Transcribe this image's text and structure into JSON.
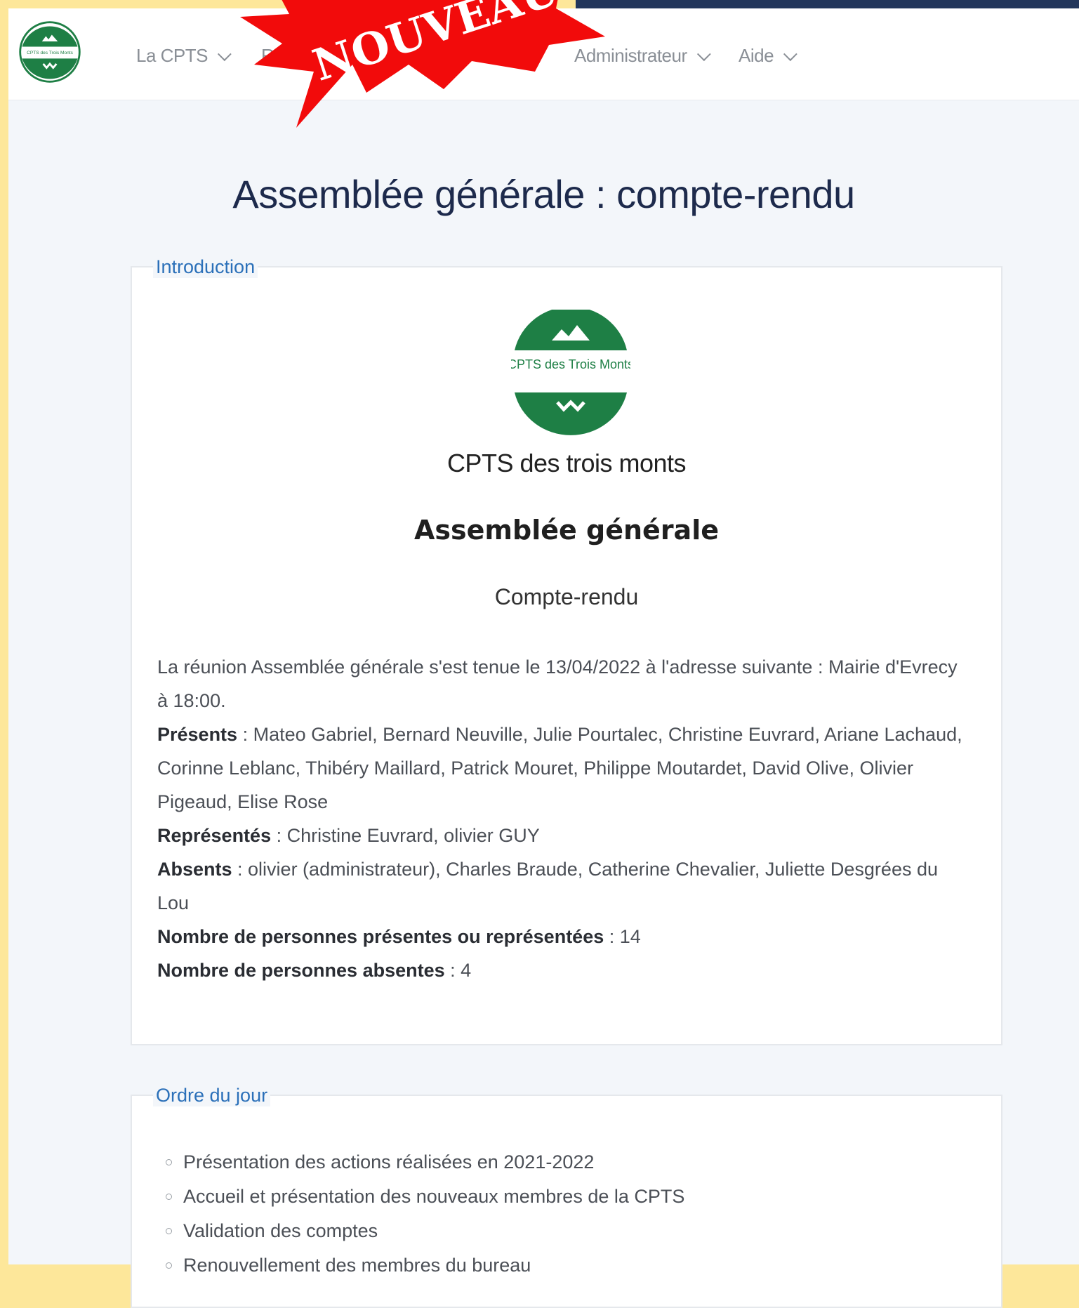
{
  "navbar": {
    "logo_text": "CPTS des Trois Monts",
    "items": [
      {
        "label": "La CPTS"
      },
      {
        "label": "Re"
      },
      {
        "label": "Administrateur"
      },
      {
        "label": "Aide"
      }
    ]
  },
  "banner": {
    "text": "NOUVEAU",
    "color": "#f20b0b"
  },
  "page": {
    "title": "Assemblée générale : compte-rendu"
  },
  "introduction": {
    "legend": "Introduction",
    "logo_text": "CPTS des Trois Monts",
    "org_name": "CPTS des trois monts",
    "doc_title": "Assemblée générale",
    "doc_subtitle": "Compte-rendu",
    "meeting_text": "La réunion Assemblée générale s'est tenue le 13/04/2022 à l'adresse suivante : Mairie d'Evrecy à 18:00.",
    "presents_label": "Présents",
    "presents_value": " : Mateo Gabriel, Bernard Neuville, Julie Pourtalec, Christine Euvrard, Ariane Lachaud, Corinne Leblanc, Thibéry Maillard, Patrick Mouret, Philippe Moutardet, David Olive, Olivier Pigeaud, Elise Rose",
    "representes_label": "Représentés",
    "representes_value": " : Christine Euvrard, olivier GUY",
    "absents_label": "Absents",
    "absents_value": " : olivier (administrateur), Charles Braude, Catherine Chevalier, Juliette Desgrées du Lou",
    "nb_presents_label": "Nombre de personnes présentes ou représentées",
    "nb_presents_value": " : 14",
    "nb_absents_label": "Nombre de personnes absentes",
    "nb_absents_value": " : 4"
  },
  "ordre_du_jour": {
    "legend": "Ordre du jour",
    "items": [
      "Présentation des actions réalisées en 2021-2022",
      "Accueil et présentation des nouveaux membres de la CPTS",
      "Validation des comptes",
      "Renouvellement des membres du bureau"
    ]
  },
  "colors": {
    "brand_green": "#1e7f45",
    "title_navy": "#1d2a4c",
    "link_blue": "#2b70b9"
  }
}
